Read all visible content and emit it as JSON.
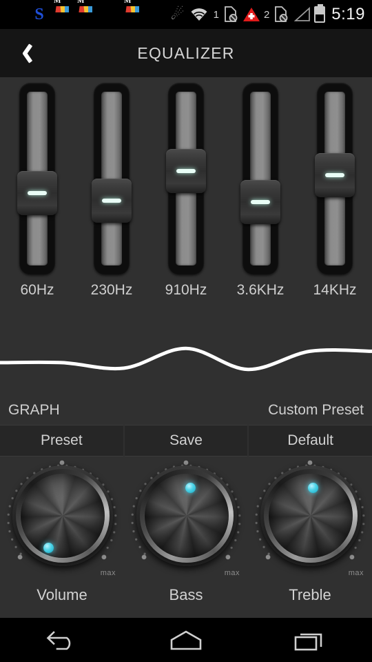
{
  "status_bar": {
    "time": "5:19",
    "left_icons": [
      {
        "name": "plus-badge-icon"
      },
      {
        "name": "s-app-icon"
      },
      {
        "name": "mail-app-icon"
      },
      {
        "name": "mail-app-icon"
      },
      {
        "name": "archive-app-icon"
      },
      {
        "name": "mail-app-icon"
      }
    ],
    "right_icons": [
      {
        "name": "bluetooth-icon"
      },
      {
        "name": "wifi-icon"
      },
      {
        "name": "no-sim-1-icon",
        "badge": "1"
      },
      {
        "name": "red-warning-triangle-icon"
      },
      {
        "name": "no-sim-2-icon",
        "badge": "2"
      },
      {
        "name": "signal-no-service-icon"
      },
      {
        "name": "battery-icon"
      }
    ]
  },
  "title_bar": {
    "back_icon": "chevron-left-icon",
    "title": "EQUALIZER"
  },
  "equalizer": {
    "bands": [
      {
        "label": "60Hz",
        "thumb_pct": 57
      },
      {
        "label": "230Hz",
        "thumb_pct": 62
      },
      {
        "label": "910Hz",
        "thumb_pct": 42
      },
      {
        "label": "3.6KHz",
        "thumb_pct": 63
      },
      {
        "label": "14KHz",
        "thumb_pct": 45
      }
    ]
  },
  "graph_row": {
    "label": "GRAPH",
    "preset_name": "Custom Preset"
  },
  "buttons": [
    {
      "label": "Preset"
    },
    {
      "label": "Save"
    },
    {
      "label": "Default"
    }
  ],
  "knobs": [
    {
      "label": "Volume",
      "max_label": "max",
      "angle_deg": 205
    },
    {
      "label": "Bass",
      "max_label": "max",
      "angle_deg": 8
    },
    {
      "label": "Treble",
      "max_label": "max",
      "angle_deg": 5
    }
  ],
  "nav_bar": {
    "buttons": [
      {
        "name": "back-button"
      },
      {
        "name": "home-button"
      },
      {
        "name": "recents-button"
      }
    ]
  },
  "colors": {
    "background": "#303030",
    "title_bar": "#151515",
    "accent_cyan": "#4fd4e8",
    "text": "#d2d2d2",
    "curve": "#ffffff"
  },
  "chart_data": {
    "type": "line",
    "title": "GRAPH",
    "x": [
      "60Hz",
      "230Hz",
      "910Hz",
      "3.6KHz",
      "14KHz"
    ],
    "series": [
      {
        "name": "Custom Preset",
        "values": [
          0.28,
          0.15,
          0.62,
          0.12,
          0.55
        ]
      }
    ],
    "ylim": [
      0,
      1
    ],
    "xlabel": "",
    "ylabel": "",
    "grid": false,
    "legend": "none"
  }
}
